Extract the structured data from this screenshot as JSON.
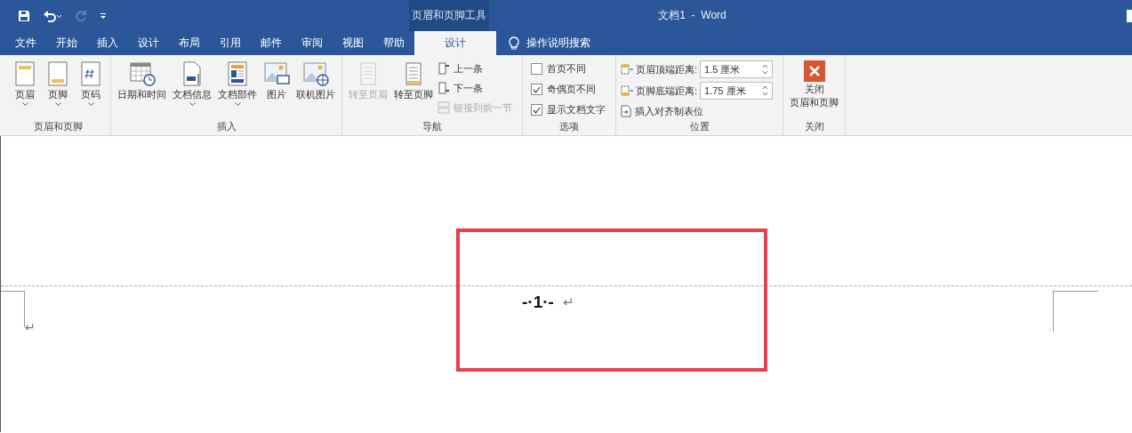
{
  "title_bar": {
    "context_tab_group": "页眉和页脚工具",
    "title": "文档1  -  Word"
  },
  "tabs": [
    {
      "label": "文件",
      "selected": false
    },
    {
      "label": "开始",
      "selected": false
    },
    {
      "label": "插入",
      "selected": false
    },
    {
      "label": "设计",
      "selected": false
    },
    {
      "label": "布局",
      "selected": false
    },
    {
      "label": "引用",
      "selected": false
    },
    {
      "label": "邮件",
      "selected": false
    },
    {
      "label": "审阅",
      "selected": false
    },
    {
      "label": "视图",
      "selected": false
    },
    {
      "label": "帮助",
      "selected": false
    },
    {
      "label": "设计",
      "selected": true,
      "contextual": true
    }
  ],
  "tell_me": {
    "placeholder": "操作说明搜索"
  },
  "ribbon": [
    {
      "label": "页眉和页脚",
      "items": [
        {
          "kind": "large",
          "label": "页眉",
          "has_menu": true,
          "disabled": false
        },
        {
          "kind": "large",
          "label": "页脚",
          "has_menu": true,
          "disabled": false
        },
        {
          "kind": "large",
          "label": "页码",
          "has_menu": true,
          "disabled": false
        }
      ]
    },
    {
      "label": "插入",
      "items": [
        {
          "kind": "large",
          "label": "日期和时间",
          "has_menu": false,
          "disabled": false
        },
        {
          "kind": "large",
          "label": "文档信息",
          "has_menu": true,
          "disabled": false
        },
        {
          "kind": "large",
          "label": "文档部件",
          "has_menu": true,
          "disabled": false
        },
        {
          "kind": "large",
          "label": "图片",
          "has_menu": false,
          "disabled": false
        },
        {
          "kind": "large",
          "label": "联机图片",
          "has_menu": false,
          "disabled": false
        }
      ]
    },
    {
      "label": "导航",
      "items": [
        {
          "kind": "large",
          "label": "转至页眉",
          "has_menu": false,
          "disabled": true
        },
        {
          "kind": "large",
          "label": "转至页脚",
          "has_menu": false,
          "disabled": false
        },
        {
          "kind": "small",
          "items": [
            {
              "label": "上一条",
              "disabled": false
            },
            {
              "label": "下一条",
              "disabled": false
            },
            {
              "label": "链接到前一节",
              "disabled": true
            }
          ]
        }
      ]
    },
    {
      "label": "选项",
      "items": [
        {
          "kind": "checkboxes",
          "items": [
            {
              "label": "首页不同",
              "checked": false
            },
            {
              "label": "奇偶页不同",
              "checked": true
            },
            {
              "label": "显示文档文字",
              "checked": true
            }
          ]
        }
      ]
    },
    {
      "label": "位置",
      "items": [
        {
          "kind": "spinners",
          "items": [
            {
              "label": "页眉顶端距离:",
              "value": "1.5 厘米"
            },
            {
              "label": "页脚底端距离:",
              "value": "1.75 厘米"
            }
          ],
          "action": "插入对齐制表位"
        }
      ]
    },
    {
      "label": "关闭",
      "items": [
        {
          "kind": "close",
          "label_lines": [
            "关闭",
            "页眉和页脚"
          ]
        }
      ]
    }
  ],
  "document": {
    "footer_text": "-·1·-",
    "footer_mark": "↵",
    "body_mark": "↵"
  }
}
